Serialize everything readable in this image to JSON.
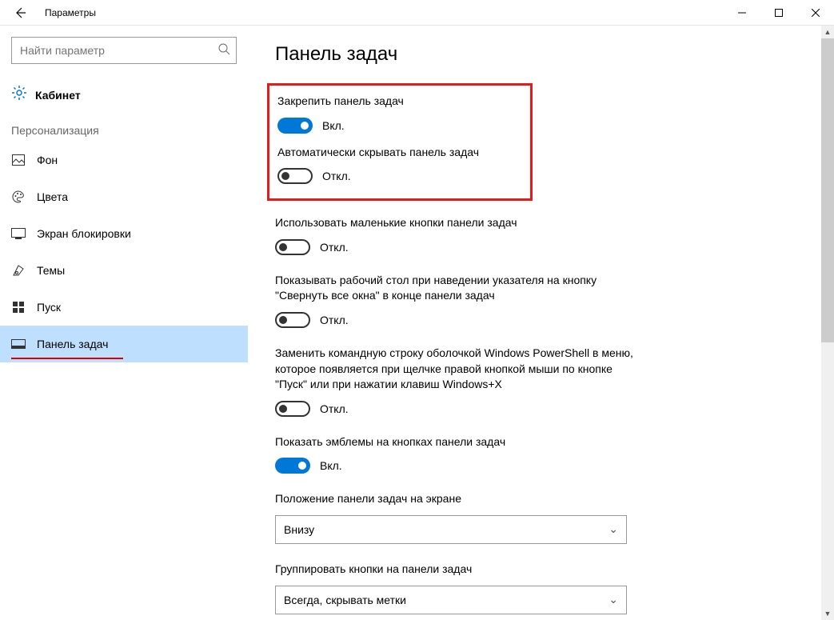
{
  "window": {
    "title": "Параметры"
  },
  "search": {
    "placeholder": "Найти параметр"
  },
  "home_label": "Кабинет",
  "group_label": "Персонализация",
  "nav": [
    {
      "label": "Фон"
    },
    {
      "label": "Цвета"
    },
    {
      "label": "Экран блокировки"
    },
    {
      "label": "Темы"
    },
    {
      "label": "Пуск"
    },
    {
      "label": "Панель задач"
    }
  ],
  "page_title": "Панель задач",
  "state_on": "Вкл.",
  "state_off": "Откл.",
  "settings": {
    "lock": {
      "label": "Закрепить панель задач",
      "on": true
    },
    "autohide": {
      "label": "Автоматически скрывать панель задач",
      "on": false
    },
    "small_buttons": {
      "label": "Использовать маленькие кнопки панели задач",
      "on": false
    },
    "peek": {
      "label": "Показывать рабочий стол при наведении указателя на кнопку \"Свернуть все окна\" в конце панели задач",
      "on": false
    },
    "powershell": {
      "label": "Заменить командную строку оболочкой Windows PowerShell в меню, которое появляется при щелчке правой кнопкой мыши по кнопке \"Пуск\" или при нажатии клавиш Windows+X",
      "on": false
    },
    "badges": {
      "label": "Показать эмблемы на кнопках панели задач",
      "on": true
    }
  },
  "dropdowns": {
    "position": {
      "label": "Положение панели задач на экране",
      "value": "Внизу"
    },
    "combine": {
      "label": "Группировать кнопки на панели задач",
      "value": "Всегда, скрывать метки"
    }
  }
}
